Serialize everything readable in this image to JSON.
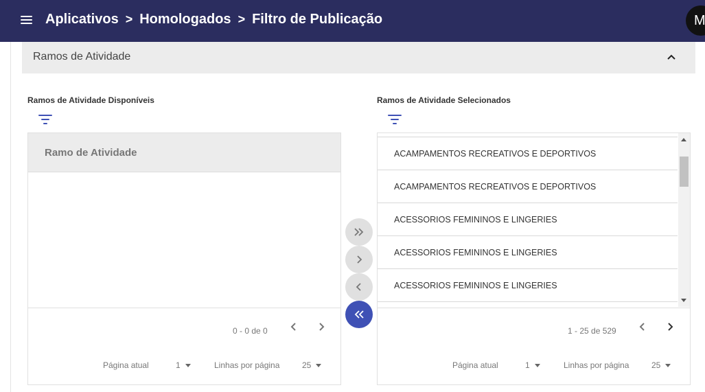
{
  "header": {
    "crumbs": [
      "Aplicativos",
      "Homologados",
      "Filtro de Publicação"
    ],
    "separator": ">",
    "avatar_initial": "M",
    "background_color": "#2b2d5f"
  },
  "section": {
    "title": "Ramos de Atividade",
    "expanded": true
  },
  "available": {
    "title": "Ramos de Atividade Disponíveis",
    "column_header": "Ramo de Atividade",
    "items": [],
    "range": "0 - 0 de 0",
    "page_label": "Página atual",
    "page_value": "1",
    "rows_label": "Linhas por página",
    "rows_value": "25"
  },
  "selected": {
    "title": "Ramos de Atividade Selecionados",
    "items": [
      "ACAMPAMENTOS RECREATIVOS E DEPORTIVOS",
      "ACAMPAMENTOS RECREATIVOS E DEPORTIVOS",
      "ACESSORIOS FEMININOS E LINGERIES",
      "ACESSORIOS FEMININOS E LINGERIES",
      "ACESSORIOS FEMININOS E LINGERIES"
    ],
    "range": "1 - 25 de 529",
    "page_label": "Página atual",
    "page_value": "1",
    "rows_label": "Linhas por página",
    "rows_value": "25"
  },
  "transfer_buttons": [
    {
      "name": "move-all-right-button",
      "icon": "double-chevron-right-icon"
    },
    {
      "name": "move-right-button",
      "icon": "chevron-right-icon"
    },
    {
      "name": "move-left-button",
      "icon": "chevron-left-icon"
    },
    {
      "name": "move-all-left-button",
      "icon": "double-chevron-left-icon"
    }
  ],
  "colors": {
    "accent": "#3f51b5",
    "header_bg": "#2b2d5f",
    "panel_header_bg": "#ececec"
  }
}
